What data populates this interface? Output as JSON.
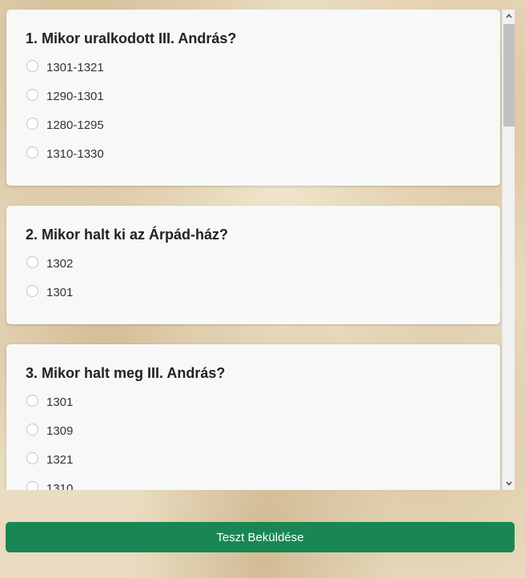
{
  "questions": [
    {
      "title": "1. Mikor uralkodott III. András?",
      "options": [
        "1301-1321",
        "1290-1301",
        "1280-1295",
        "1310-1330"
      ]
    },
    {
      "title": "2. Mikor halt ki az Árpád-ház?",
      "options": [
        "1302",
        "1301"
      ]
    },
    {
      "title": "3. Mikor halt meg III. András?",
      "options": [
        "1301",
        "1309",
        "1321",
        "1310"
      ]
    }
  ],
  "submit_label": "Teszt Beküldése",
  "colors": {
    "submit_button": "#198754",
    "card_background": "#f8f8f8",
    "page_background": "#e9dcc0"
  },
  "icons": {
    "scroll_up": "chevron-up-icon",
    "scroll_down": "chevron-down-icon"
  }
}
